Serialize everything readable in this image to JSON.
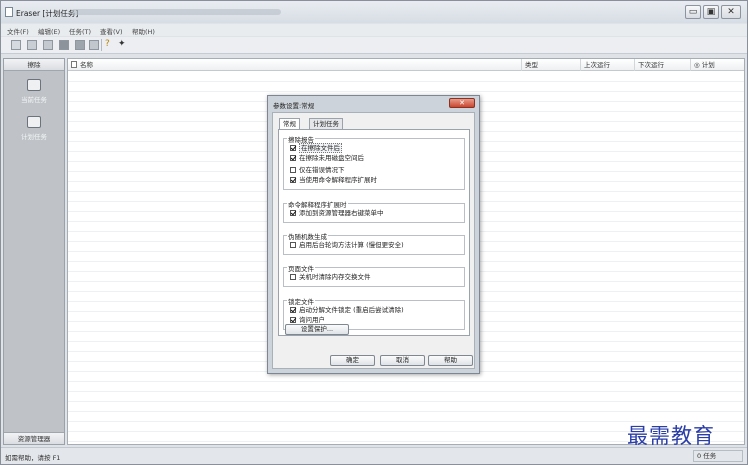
{
  "window": {
    "title": "Eraser [计划任务]",
    "controls": {
      "minimize": "▭",
      "maximize": "▣",
      "close": "✕"
    }
  },
  "menu": [
    "文件(F)",
    "编辑(E)",
    "任务(T)",
    "查看(V)",
    "帮助(H)"
  ],
  "toolbar": {
    "icons": [
      "new-task-icon",
      "view-icon",
      "list-icon",
      "stop-icon",
      "save-icon",
      "delete-icon",
      "help-icon",
      "about-icon"
    ]
  },
  "sidebar": {
    "header": "擦除",
    "items": [
      {
        "label": "当前任务",
        "icon": "current-task-icon"
      },
      {
        "label": "计划任务",
        "icon": "scheduled-task-icon"
      }
    ],
    "footer": "资源管理器"
  },
  "task_list": {
    "columns": [
      "名称",
      "类型",
      "上次运行",
      "下次运行",
      "计划"
    ]
  },
  "status": {
    "left": "如需帮助，请按 F1",
    "right": "0 任务"
  },
  "watermark": "最需教育",
  "dialog": {
    "title": "参数设置:常规",
    "close": "✕",
    "tabs": [
      "常规",
      "计划任务"
    ],
    "groups": [
      {
        "title": "擦除报告",
        "options": [
          {
            "label": "在擦除文件后",
            "checked": true
          },
          {
            "label": "在擦除未用磁盘空间后",
            "checked": true
          },
          {
            "label": "仅在错误情况下",
            "checked": false
          },
          {
            "label": "当使用命令解释程序扩展时",
            "checked": true
          }
        ]
      },
      {
        "title": "命令解释程序扩展时",
        "options": [
          {
            "label": "添加到资源管理器右键菜单中",
            "checked": true
          }
        ]
      },
      {
        "title": "伪随机数生成",
        "options": [
          {
            "label": "启用后台轮询方法计算 (慢但更安全)",
            "checked": false
          }
        ]
      },
      {
        "title": "页面文件",
        "options": [
          {
            "label": "关机时清除内存交换文件",
            "checked": false
          }
        ]
      },
      {
        "title": "锁定文件",
        "options": [
          {
            "label": "启动分解文件锁定 (重启后尝试清除)",
            "checked": true
          },
          {
            "label": "询问用户",
            "checked": true
          }
        ]
      }
    ],
    "protect_button": "设置保护...",
    "ok": "确定",
    "cancel": "取消",
    "help": "帮助"
  }
}
